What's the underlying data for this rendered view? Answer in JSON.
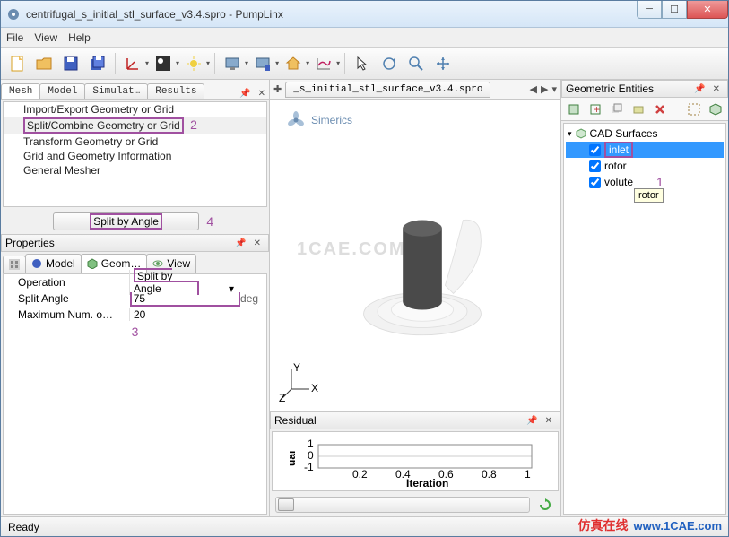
{
  "titlebar": {
    "title": "centrifugal_s_initial_stl_surface_v3.4.spro - PumpLinx"
  },
  "menu": {
    "file": "File",
    "view": "View",
    "help": "Help"
  },
  "left_tabs": {
    "mesh": "Mesh",
    "model": "Model",
    "sim": "Simulat…",
    "results": "Results"
  },
  "tree": {
    "items": [
      "Import/Export Geometry or Grid",
      "Split/Combine Geometry or Grid",
      "Transform Geometry or Grid",
      "Grid and Geometry Information",
      "General Mesher"
    ]
  },
  "annot": {
    "a1": "1",
    "a2": "2",
    "a3": "3",
    "a4": "4"
  },
  "split_btn": "Split by Angle",
  "properties": {
    "title": "Properties",
    "tabs": {
      "model": "Model",
      "geom": "Geom…",
      "view": "View"
    },
    "rows": {
      "op_k": "Operation",
      "op_v": "Split by Angle",
      "ang_k": "Split Angle",
      "ang_v": "75",
      "ang_u": "deg",
      "max_k": "Maximum Num. o…",
      "max_v": "20"
    }
  },
  "view_tab": "_s_initial_stl_surface_v3.4.spro",
  "simerics": "Simerics",
  "watermark": "1CAE.COM",
  "axis": {
    "y": "Y",
    "z": "Z",
    "x": "X"
  },
  "residual": {
    "title": "Residual",
    "xlabel": "Iteration",
    "ylabel": "ual"
  },
  "chart_data": {
    "type": "line",
    "x_ticks": [
      0.2,
      0.4,
      0.6,
      0.8,
      1
    ],
    "y_ticks": [
      -1,
      0,
      1
    ],
    "xlabel": "Iteration",
    "ylabel": "ual",
    "series": []
  },
  "ge": {
    "title": "Geometric Entities",
    "root": "CAD Surfaces",
    "items": [
      "inlet",
      "rotor",
      "volute"
    ],
    "tooltip": "rotor"
  },
  "status": "Ready",
  "site": {
    "cn": "仿真在线",
    "en": "www.1CAE.com"
  }
}
